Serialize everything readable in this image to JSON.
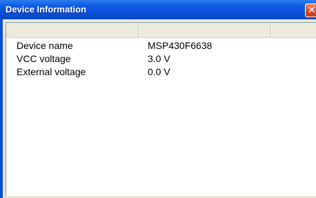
{
  "window": {
    "title": "Device Information",
    "close_icon": "close-icon"
  },
  "table": {
    "columns": [
      "",
      "",
      ""
    ],
    "rows": [
      {
        "label": "Device name",
        "value": "MSP430F6638"
      },
      {
        "label": "VCC voltage",
        "value": "3.0 V"
      },
      {
        "label": "External voltage",
        "value": "0.0 V"
      }
    ]
  },
  "colors": {
    "titlebar": "#0a4fd6",
    "close_button": "#d9532e",
    "dialog_background": "#ece9d8",
    "header_background": "#ebeadb"
  }
}
